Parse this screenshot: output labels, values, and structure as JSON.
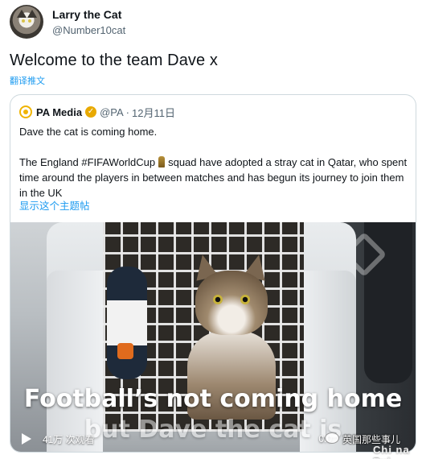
{
  "author": {
    "display_name": "Larry the Cat",
    "handle": "@Number10cat"
  },
  "tweet": {
    "text": "Welcome to the team Dave x",
    "translate_label": "翻译推文"
  },
  "quoted": {
    "name": "PA Media",
    "handle": "@PA",
    "separator": "·",
    "date": "12月11日",
    "line1": "Dave the cat is coming home.",
    "line2_before": "The England #FIFAWorldCup",
    "line2_after": "squad have adopted a stray cat in Qatar, who spent time around the players in between matches and has begun its journey to join them in the UK",
    "show_thread": "显示这个主题帖"
  },
  "video": {
    "caption_line1": "Football’s not coming home",
    "caption_line2": "but Dave the cat is",
    "views": "41万 次观看",
    "timer": "0:0"
  },
  "watermark": {
    "text": "英国那些事儿",
    "sub": "Chi na Zui"
  },
  "colors": {
    "link": "#1d9bf0",
    "secondary_text": "#536471",
    "border": "#cfd9de",
    "verified_badge": "#e8a900",
    "pa_logo": "#f0b400"
  },
  "icons": [
    "verified-badge-icon",
    "trophy-icon",
    "play-icon",
    "pa-media-logo",
    "wechat-icon"
  ]
}
